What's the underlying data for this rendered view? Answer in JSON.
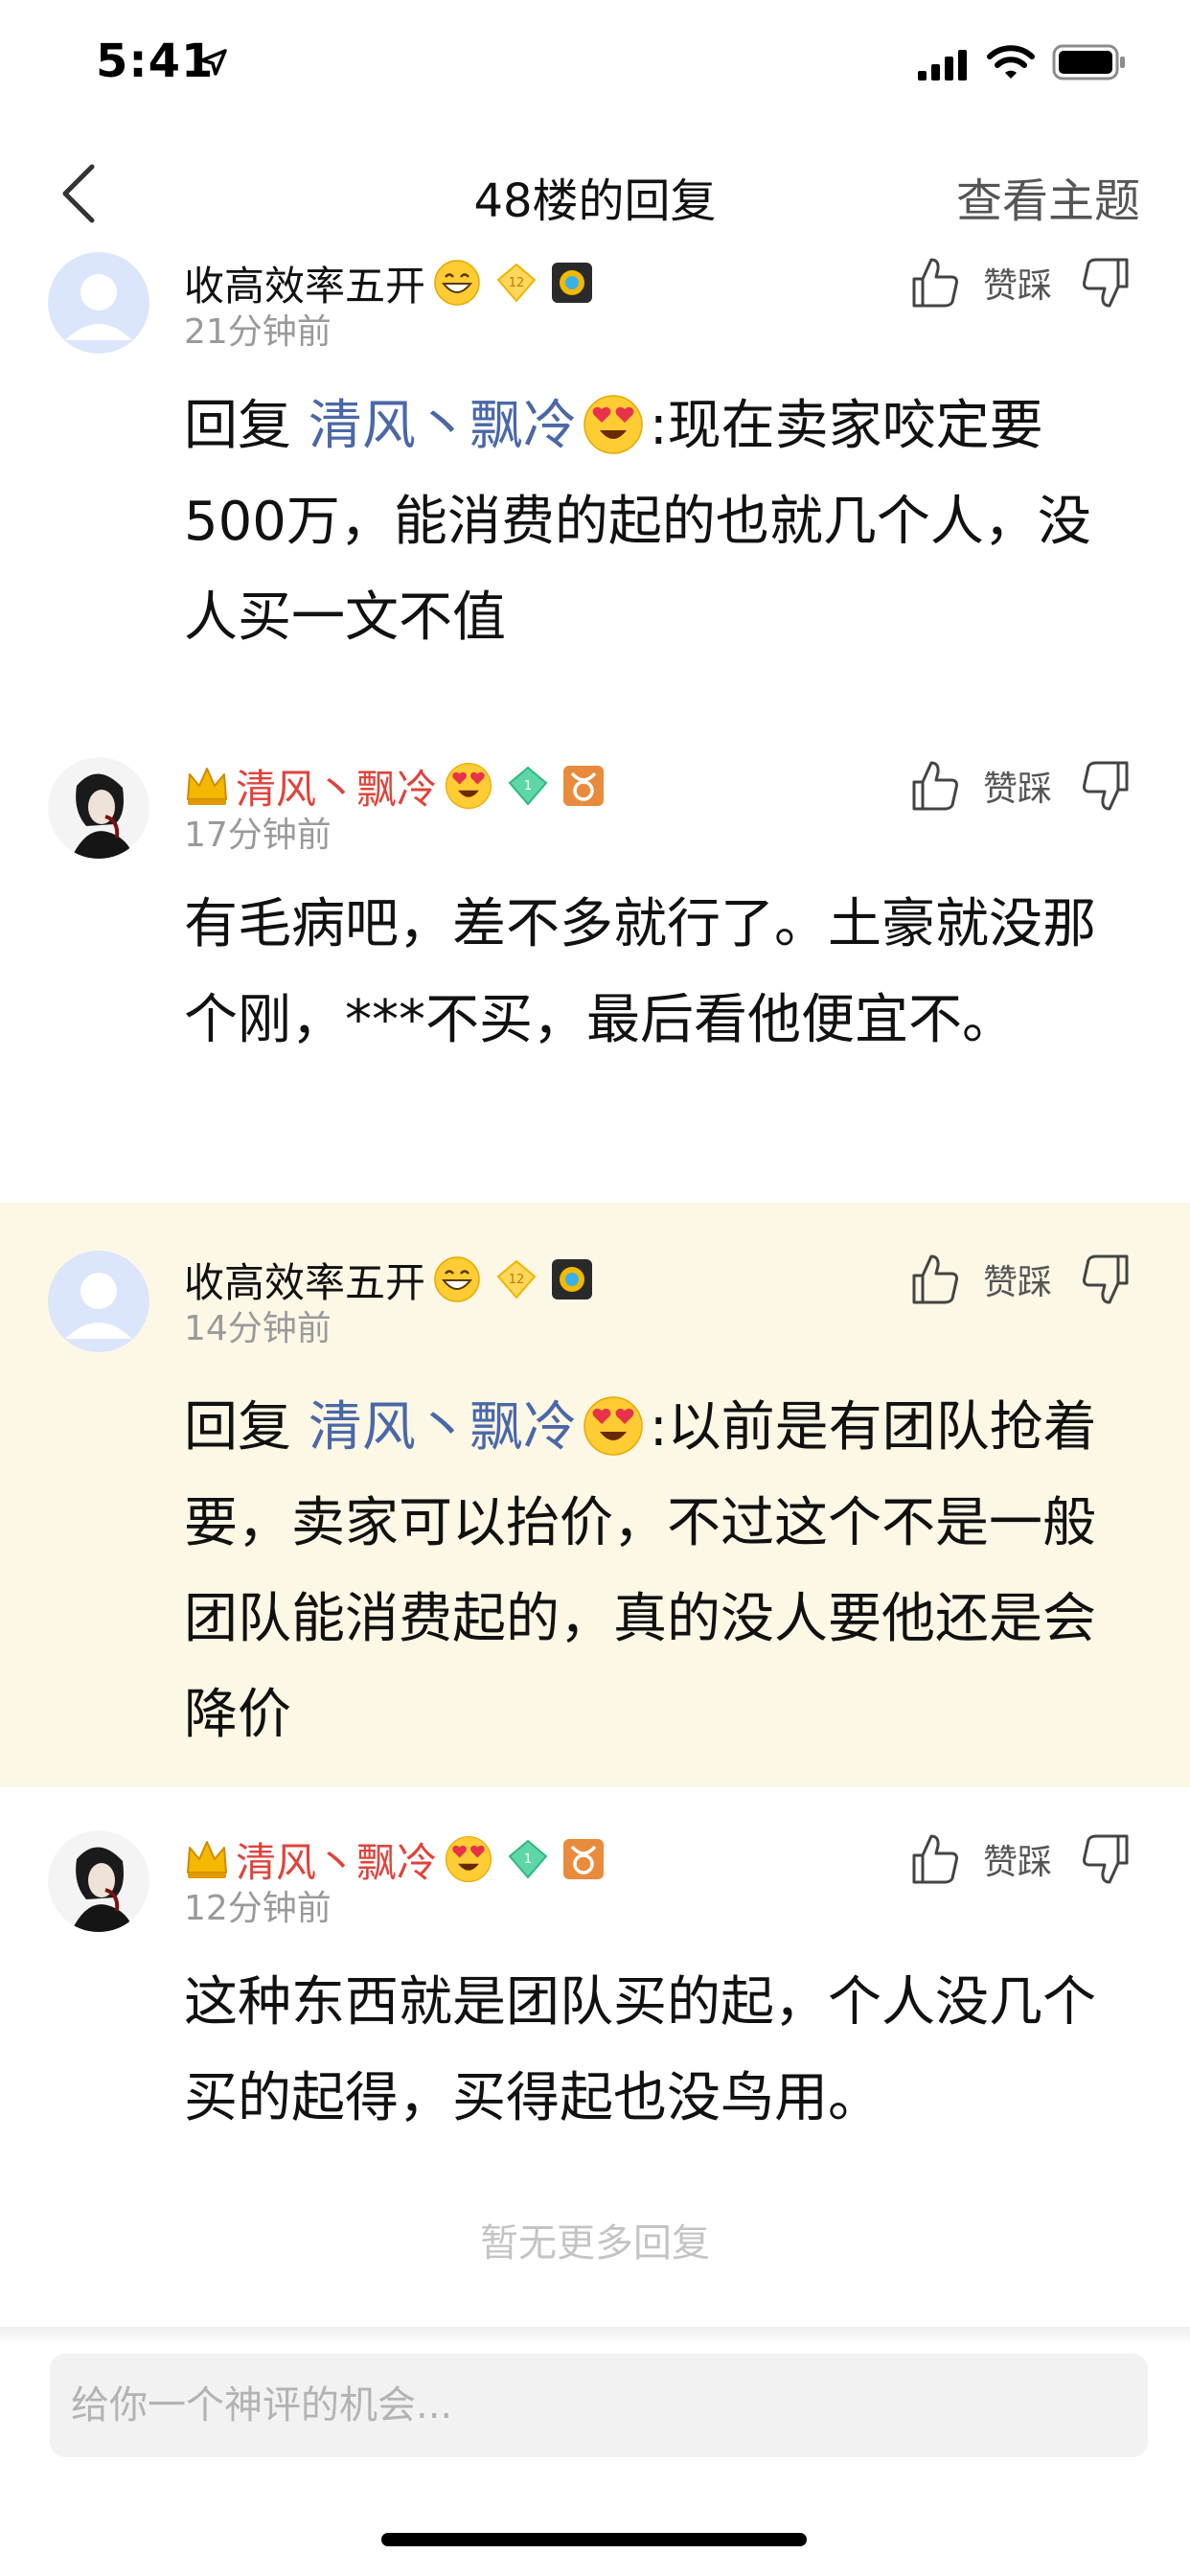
{
  "status_bar": {
    "time": "5:41"
  },
  "nav": {
    "title": "48楼的回复",
    "right_label": "查看主题"
  },
  "actions_label": "赞踩",
  "comments": [
    {
      "user": "收高效率五开",
      "time_ago": "21分钟前",
      "reply_prefix": "回复 ",
      "mention": "清风丶飘冷",
      "text": ":现在卖家咬定要500万，能消费的起的也就几个人，没人买一文不值",
      "highlighted": false
    },
    {
      "user": "清风丶飘冷",
      "time_ago": "17分钟前",
      "text": "有毛病吧，差不多就行了。土豪就没那个刚，***不买，最后看他便宜不。",
      "highlighted": false
    },
    {
      "user": "收高效率五开",
      "time_ago": "14分钟前",
      "reply_prefix": "回复 ",
      "mention": "清风丶飘冷",
      "text": ":以前是有团队抢着要，卖家可以抬价，不过这个不是一般团队能消费起的，真的没人要他还是会降价",
      "highlighted": true
    },
    {
      "user": "清风丶飘冷",
      "time_ago": "12分钟前",
      "text": "这种东西就是团队买的起，个人没几个买的起得，买得起也没鸟用。",
      "highlighted": false
    }
  ],
  "no_more": "暂无更多回复",
  "input": {
    "placeholder": "给你一个神评的机会..."
  },
  "colors": {
    "highlight_bg": "#fdf7e6",
    "mention": "#4a68a8",
    "username_red": "#e0433c"
  },
  "icons": [
    "location-arrow-icon",
    "signal-icon",
    "wifi-icon",
    "battery-icon",
    "back-chevron-icon",
    "thumbs-up-icon",
    "thumbs-down-icon",
    "crown-icon",
    "grin-emoji-icon",
    "heart-eyes-emoji-icon",
    "level-badge-icon",
    "diamond-badge-icon",
    "gear-badge-icon",
    "taurus-badge-icon"
  ]
}
